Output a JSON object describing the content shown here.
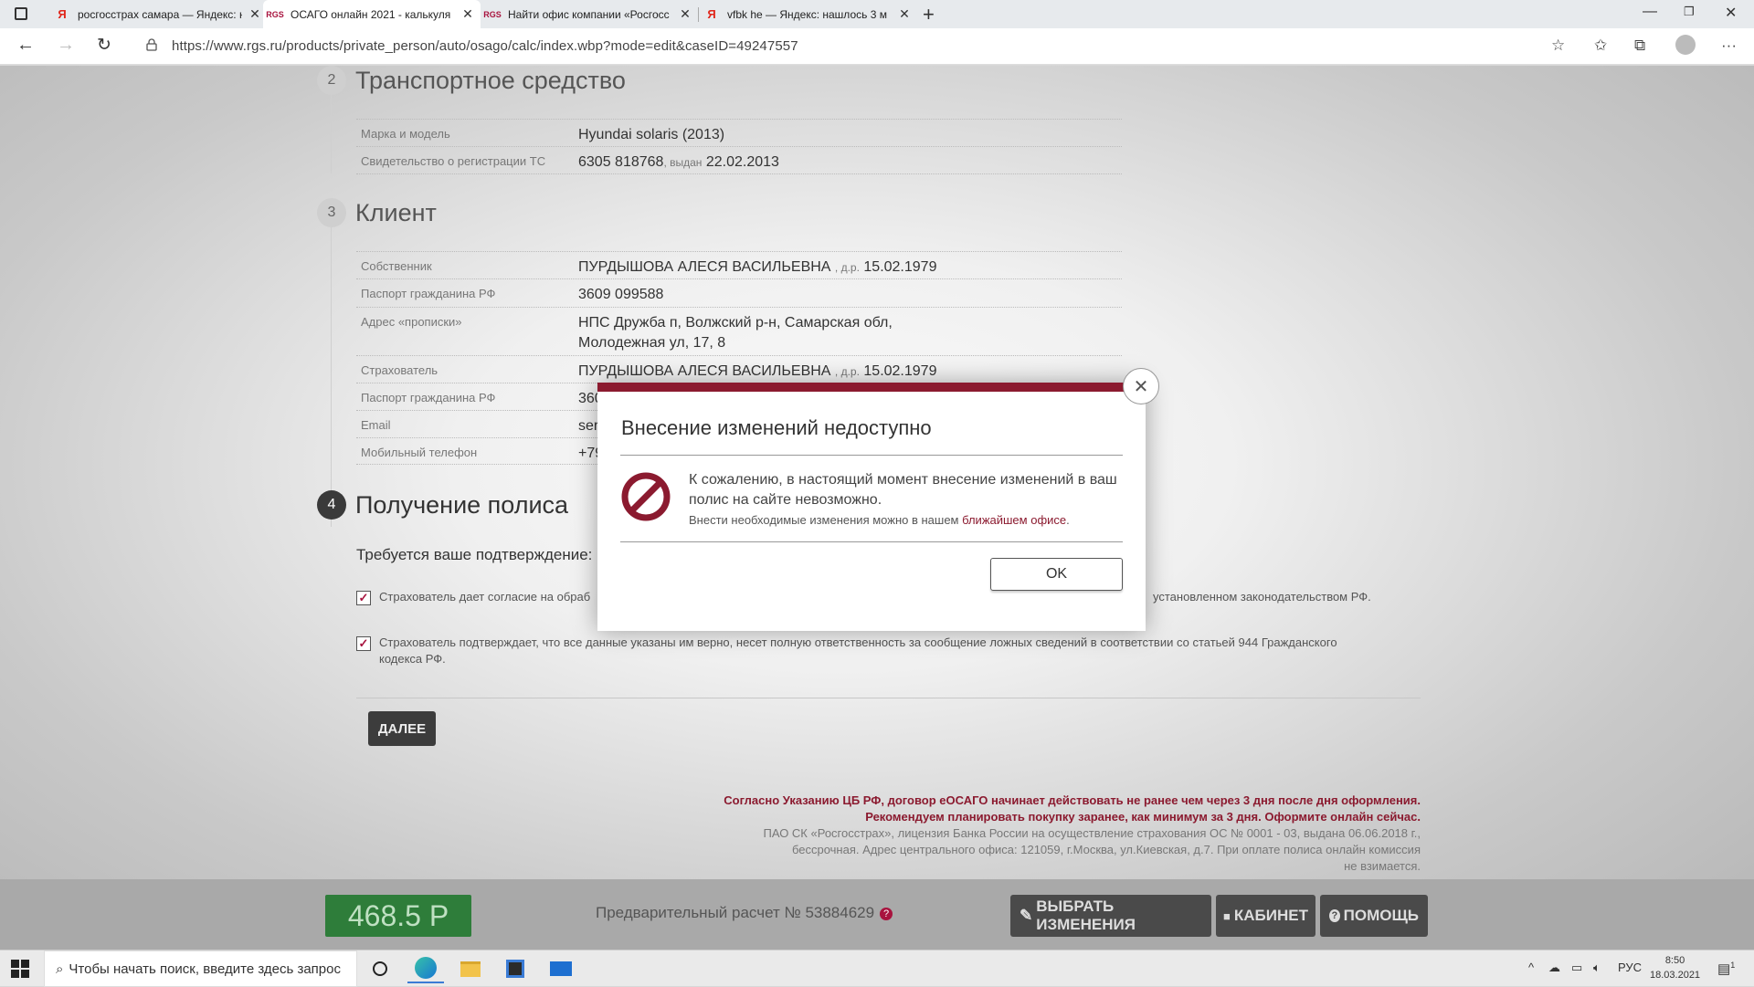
{
  "browser": {
    "tabs": [
      {
        "favicon": "Я",
        "title": "росгосстрах самара — Яндекс: н",
        "active": false
      },
      {
        "favicon": "RGS",
        "title": "ОСАГО онлайн 2021 - калькуля",
        "active": true
      },
      {
        "favicon": "RGS",
        "title": "Найти офис компании «Росгосс",
        "active": false
      },
      {
        "favicon": "Я",
        "title": "vfbk he — Яндекс: нашлось 3 м",
        "active": false
      }
    ],
    "url": "https://www.rgs.ru/products/private_person/auto/osago/calc/index.wbp?mode=edit&caseID=49247557"
  },
  "vehicle": {
    "step": "2",
    "title": "Транспортное средство",
    "rows": [
      {
        "label": "Марка и модель",
        "value": "Hyundai solaris (2013)"
      },
      {
        "label": "Свидетельство о регистрации ТС",
        "value": "6305 818768",
        "issued_label": ", выдан",
        "issued_date": "22.02.2013"
      }
    ]
  },
  "client": {
    "step": "3",
    "title": "Клиент",
    "owner_label": "Собственник",
    "owner_name": "ПУРДЫШОВА АЛЕСЯ ВАСИЛЬЕВНА",
    "dob_label": ", д.р.",
    "owner_dob": "15.02.1979",
    "passport_label": "Паспорт гражданина РФ",
    "passport_value": "3609 099588",
    "address_label": "Адрес «прописки»",
    "address_line1": "НПС Дружба п, Волжский р-н, Самарская обл,",
    "address_line2": "Молодежная ул, 17, 8",
    "insurer_label": "Страхователь",
    "insurer_name": "ПУРДЫШОВА АЛЕСЯ ВАСИЛЬЕВНА",
    "insurer_dob": "15.02.1979",
    "insurer_passport_label": "Паспорт гражданина РФ",
    "insurer_passport_partial": "360",
    "email_label": "Email",
    "email_partial": "ser",
    "phone_label": "Мобильный телефон",
    "phone_partial": "+79"
  },
  "policy": {
    "step": "4",
    "title": "Получение полиса",
    "confirm_question": "Требуется ваше подтверждение:",
    "consent1_left": "Страхователь дает согласие на обраб",
    "consent1_right": "установленном законодательством РФ.",
    "consent2": "Страхователь подтверждает, что все данные указаны им верно, несет полную ответственность за сообщение ложных сведений в соответствии со статьей 944 Гражданского",
    "consent2_cont": "кодекса РФ.",
    "next_label": "ДАЛЕЕ"
  },
  "notices": {
    "line1": "Согласно Указанию ЦБ РФ, договор еОСАГО начинает действовать не ранее чем через 3 дня после дня оформления.",
    "line2": "Рекомендуем планировать покупку заранее, как минимум за 3 дня. Оформите онлайн сейчас.",
    "line3": "ПАО СК «Росгосстрах», лицензия Банка России на осуществление страхования ОС № 0001 - 03, выдана 06.06.2018 г.,",
    "line4": "бессрочная. Адрес центрального офиса: 121059, г.Москва, ул.Киевская, д.7. При оплате полиса онлайн комиссия",
    "line5": "не взимается."
  },
  "bottom_bar": {
    "price": "468.5 Р",
    "calc_label": "Предварительный расчет № 53884629",
    "select_changes": "ВЫБРАТЬ ИЗМЕНЕНИЯ",
    "cabinet": "КАБИНЕТ",
    "help": "ПОМОЩЬ"
  },
  "modal": {
    "title": "Внесение изменений недоступно",
    "message": "К сожалению, в настоящий момент внесение изменений в ваш полис на сайте невозможно.",
    "sub_text": "Внести необходимые изменения можно в нашем",
    "sub_link": "ближайшем офисе",
    "sub_end": ".",
    "ok": "OK"
  },
  "taskbar": {
    "search_placeholder": "Чтобы начать поиск, введите здесь запрос",
    "lang": "РУС",
    "time": "8:50",
    "date": "18.03.2021",
    "notif_count": "1"
  },
  "colors": {
    "brand": "#8b1a2f",
    "price_bg": "#2e7d3a"
  }
}
